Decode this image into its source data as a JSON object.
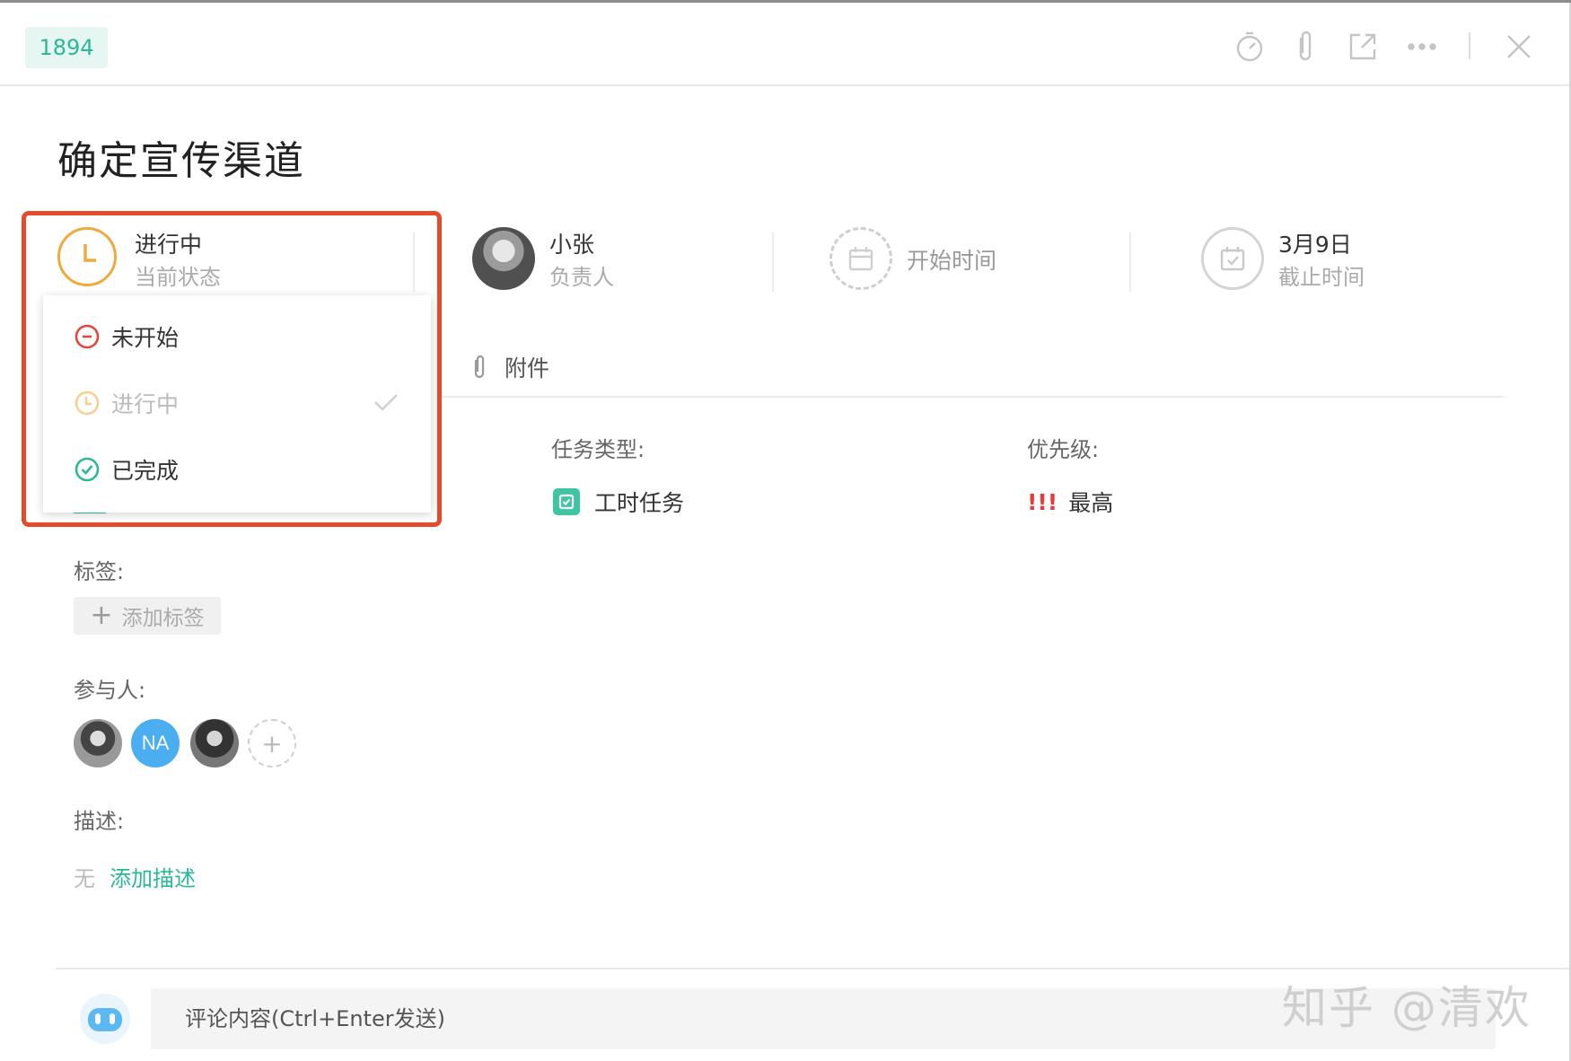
{
  "header": {
    "task_id": "1894",
    "tools": [
      "timer-icon",
      "attachment-icon",
      "open-external-icon",
      "more-icon",
      "close-icon"
    ]
  },
  "task": {
    "title": "确定宣传渠道"
  },
  "meta": {
    "status": {
      "value": "进行中",
      "label": "当前状态"
    },
    "assignee": {
      "value": "小张",
      "label": "负责人"
    },
    "start_time": {
      "label": "开始时间"
    },
    "due_time": {
      "value": "3月9日",
      "label": "截止时间"
    }
  },
  "status_dropdown": {
    "items": [
      {
        "label": "未开始",
        "color": "#e0473b",
        "icon": "minus-circle-icon"
      },
      {
        "label": "进行中",
        "color": "#f0a93b",
        "icon": "clock-icon",
        "selected": true
      },
      {
        "label": "已完成",
        "color": "#2bb895",
        "icon": "check-circle-icon"
      }
    ]
  },
  "tabs": {
    "attachment": "附件"
  },
  "fields": {
    "task_type_label": "任务类型:",
    "task_type_value": "工时任务",
    "priority_label": "优先级:",
    "priority_mark": "!!!",
    "priority_value": "最高",
    "tags_label": "标签:",
    "add_tag": "添加标签",
    "participants_label": "参与人:",
    "participant_initials": "NA",
    "description_label": "描述:",
    "description_empty": "无",
    "add_description": "添加描述"
  },
  "comment": {
    "placeholder": "评论内容(Ctrl+Enter发送)"
  },
  "watermark": "知乎 @清欢",
  "colors": {
    "accent": "#2bb895",
    "in_progress": "#f0a93b",
    "highlight": "#e54b2a",
    "priority": "#e23c3c"
  }
}
